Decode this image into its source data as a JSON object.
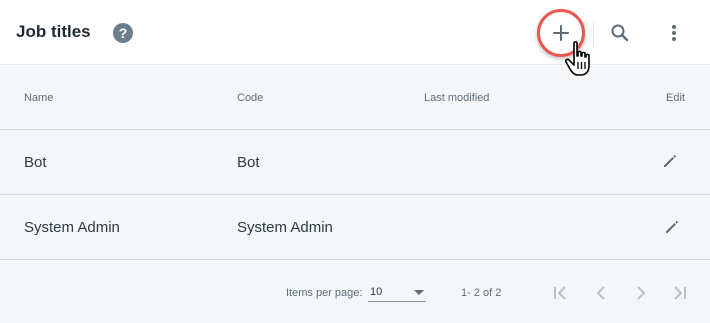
{
  "header": {
    "title": "Job titles",
    "help_glyph": "?",
    "icons": {
      "help": "help-circle-icon",
      "add": "plus-icon",
      "search": "search-icon",
      "more": "more-vert-icon",
      "cursor": "hand-pointer-icon"
    },
    "accent_color": "#e9574d"
  },
  "table": {
    "columns": {
      "name": "Name",
      "code": "Code",
      "last_modified": "Last modified",
      "edit": "Edit"
    },
    "rows": [
      {
        "name": "Bot",
        "code": "Bot",
        "last_modified": ""
      },
      {
        "name": "System Admin",
        "code": "System Admin",
        "last_modified": ""
      }
    ]
  },
  "footer": {
    "items_per_page_label": "Items per page:",
    "items_per_page_value": "10",
    "range": "1- 2 of 2",
    "icons": [
      "first-page-icon",
      "chevron-left-icon",
      "chevron-right-icon",
      "last-page-icon"
    ]
  }
}
